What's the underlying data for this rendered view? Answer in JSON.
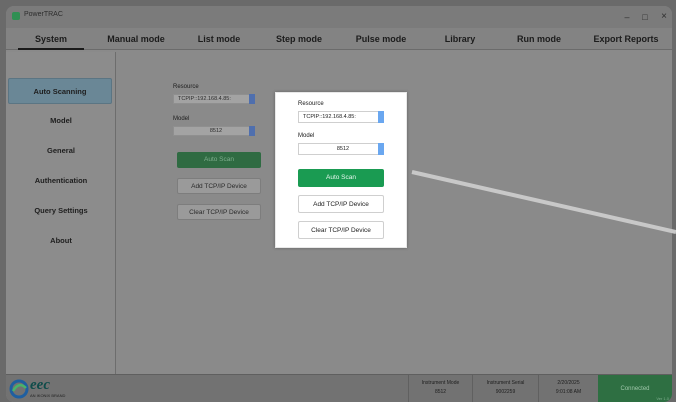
{
  "app": {
    "title": "PowerTRAC"
  },
  "window_controls": {
    "minimize": "–",
    "maximize": "□",
    "close": "×"
  },
  "menu": {
    "tabs": [
      {
        "label": "System"
      },
      {
        "label": "Manual mode"
      },
      {
        "label": "List mode"
      },
      {
        "label": "Step mode"
      },
      {
        "label": "Pulse mode"
      },
      {
        "label": "Library"
      },
      {
        "label": "Run mode"
      },
      {
        "label": "Export Reports"
      }
    ],
    "active": "System"
  },
  "sidebar": {
    "items": [
      {
        "label": "Auto Scanning"
      },
      {
        "label": "Model"
      },
      {
        "label": "General"
      },
      {
        "label": "Authentication"
      },
      {
        "label": "Query Settings"
      },
      {
        "label": "About"
      }
    ],
    "active": "Auto Scanning"
  },
  "form": {
    "resource_label": "Resource",
    "resource_value": "TCPIP::192.168.4.85:",
    "model_label": "Model",
    "model_value": "8512",
    "auto_scan": "Auto Scan",
    "add_device": "Add TCP/IP Device",
    "clear_device": "Clear TCP/IP Device"
  },
  "status": {
    "logo": "eec",
    "logo_sub": "AN IKONIX BRAND",
    "instrument_mode_label": "Instrument Mode",
    "instrument_mode_value": "8512",
    "instrument_serial_label": "Instrument Serial",
    "instrument_serial_value": "9002259",
    "date": "2/20/2025",
    "time": "9:01:08 AM",
    "connection": "Connected",
    "version": "Ver 1.0"
  },
  "colors": {
    "accent_green": "#1a9b52",
    "active_blue": "#6a8796",
    "dropdown_blue": "#6aa7f0"
  },
  "icons": {
    "app": "app-logo-icon",
    "dropdown": "chevron-down-icon"
  }
}
